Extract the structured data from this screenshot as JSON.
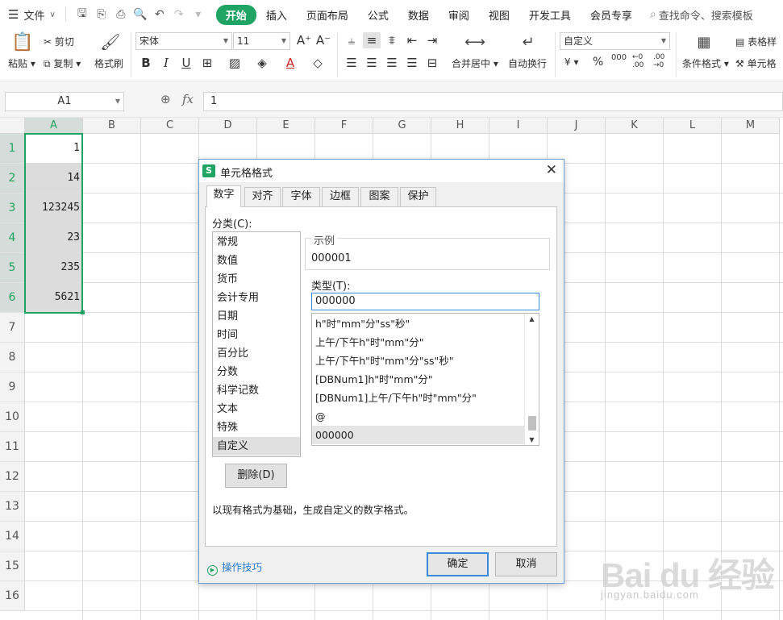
{
  "menubar": {
    "file_label": "文件",
    "tabs": [
      "开始",
      "插入",
      "页面布局",
      "公式",
      "数据",
      "审阅",
      "视图",
      "开发工具",
      "会员专享"
    ],
    "search_text": "查找命令、搜索模板"
  },
  "ribbon": {
    "paste": "粘贴",
    "cut": "剪切",
    "copy": "复制",
    "format_painter": "格式刷",
    "font_name": "宋体",
    "font_size": "11",
    "bold": "B",
    "italic": "I",
    "underline": "U",
    "merge_center": "合并居中",
    "wrap_text": "自动换行",
    "number_format": "自定义",
    "currency_symbol": "¥",
    "percent_symbol": "%",
    "thousands_symbol": "000",
    "conditional_format": "条件格式",
    "table_style": "表格样",
    "cell_style": "单元格"
  },
  "formula_bar": {
    "name_box": "A1",
    "fx": "fx",
    "value": "1"
  },
  "grid": {
    "columns": [
      "A",
      "B",
      "C",
      "D",
      "E",
      "F",
      "G",
      "H",
      "I",
      "J",
      "K",
      "L",
      "M"
    ],
    "rows": [
      "1",
      "2",
      "3",
      "4",
      "5",
      "6",
      "7",
      "8",
      "9",
      "10",
      "11",
      "12",
      "13",
      "14",
      "15",
      "16"
    ],
    "column_a_values": [
      "1",
      "14",
      "123245",
      "23",
      "235",
      "5621"
    ]
  },
  "dialog": {
    "title": "单元格格式",
    "tabs": [
      "数字",
      "对齐",
      "字体",
      "边框",
      "图案",
      "保护"
    ],
    "category_label": "分类(C):",
    "categories": [
      "常规",
      "数值",
      "货币",
      "会计专用",
      "日期",
      "时间",
      "百分比",
      "分数",
      "科学记数",
      "文本",
      "特殊",
      "自定义"
    ],
    "selected_category": "自定义",
    "sample_label": "示例",
    "sample_value": "000001",
    "type_label": "类型(T):",
    "type_value": "000000",
    "type_list": [
      "h\"时\"mm\"分\"ss\"秒\"",
      "上午/下午h\"时\"mm\"分\"",
      "上午/下午h\"时\"mm\"分\"ss\"秒\"",
      "[DBNum1]h\"时\"mm\"分\"",
      "[DBNum1]上午/下午h\"时\"mm\"分\"",
      "@",
      "000000"
    ],
    "delete_button": "删除(D)",
    "description": "以现有格式为基础，生成自定义的数字格式。",
    "tips_link": "操作技巧",
    "ok_button": "确定",
    "cancel_button": "取消"
  },
  "watermark": {
    "logo": "Bai du 经验",
    "url": "jingyan.baidu.com"
  },
  "colors": {
    "accent_green": "#1fa463",
    "dialog_border": "#6aa0d8",
    "focus_blue": "#3c8ad8",
    "link_blue": "#2d7dd2"
  }
}
